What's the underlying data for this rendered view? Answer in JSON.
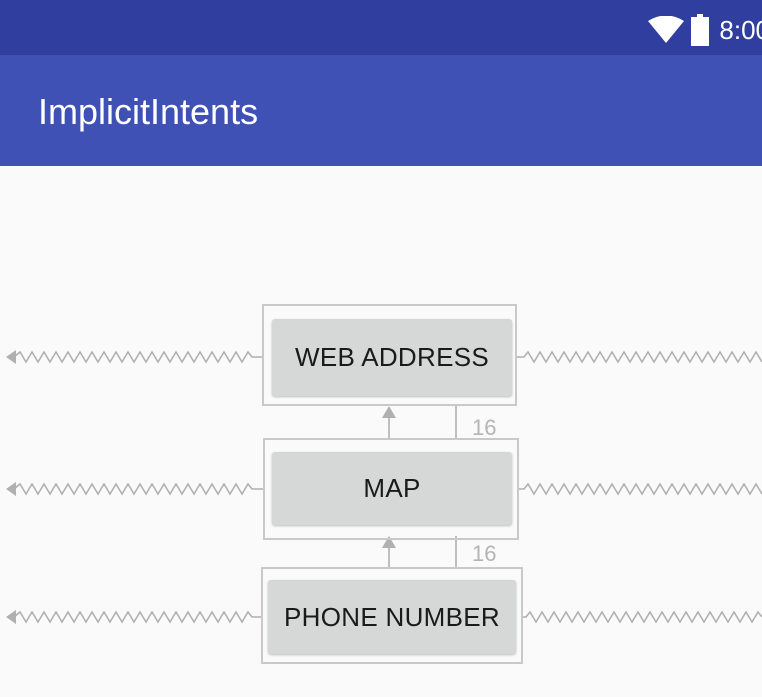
{
  "status_bar": {
    "time": "8:00",
    "icons": [
      "wifi-icon",
      "battery-icon"
    ],
    "background": "#303f9f"
  },
  "app_bar": {
    "title": "ImplicitIntents",
    "background": "#3f51b5"
  },
  "buttons": {
    "web_address": "WEB ADDRESS",
    "map": "MAP",
    "phone_number": "PHONE NUMBER"
  },
  "constraints": {
    "map_to_web_margin": "16",
    "phone_to_map_margin": "16"
  },
  "colors": {
    "button_background": "#d6d7d7",
    "constraint_line": "#b0b0b0"
  }
}
